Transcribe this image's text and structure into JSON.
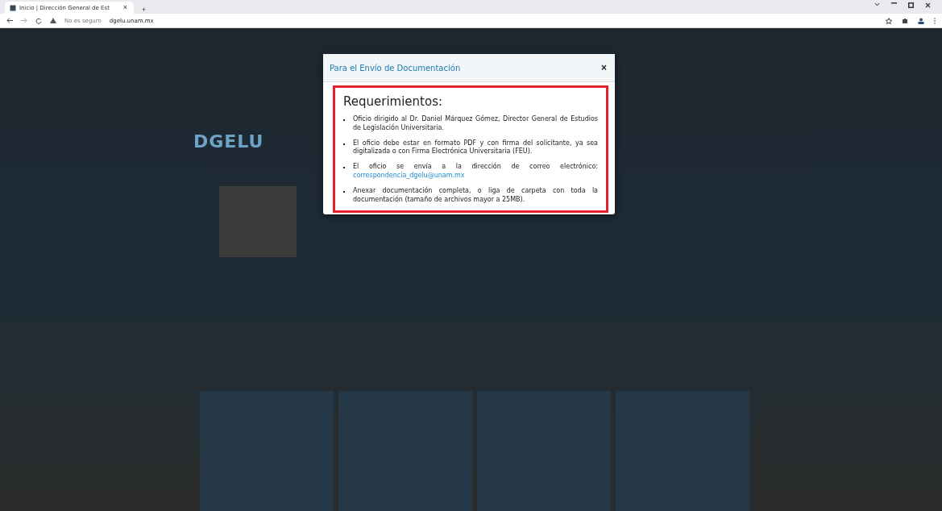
{
  "browser": {
    "tab_title": "Inicio | Dirección General de Est",
    "tab_close": "×",
    "new_tab": "+",
    "security_label": "No es seguro",
    "url": "dgelu.unam.mx"
  },
  "page": {
    "brand": "DGELU"
  },
  "modal": {
    "title": "Para el Envío de Documentación",
    "close": "×",
    "heading": "Requerimientos:",
    "items": [
      {
        "text": "Oficio dirigido al Dr. Daniel Márquez Gómez, Director General de Estudios de Legislación Universitaria."
      },
      {
        "text": "El oficio debe estar en formato PDF y con firma del solicitante, ya sea digitalizada o con Firma Electrónica Universitaria (FEU)."
      },
      {
        "text": "El oficio se envía a la dirección de correo electrónico:",
        "link": "correspondencia_dgelu@unam.mx"
      },
      {
        "text": "Anexar documentación completa, o liga de carpeta con toda la documentación (tamaño de archivos mayor a 25MB)."
      }
    ]
  }
}
